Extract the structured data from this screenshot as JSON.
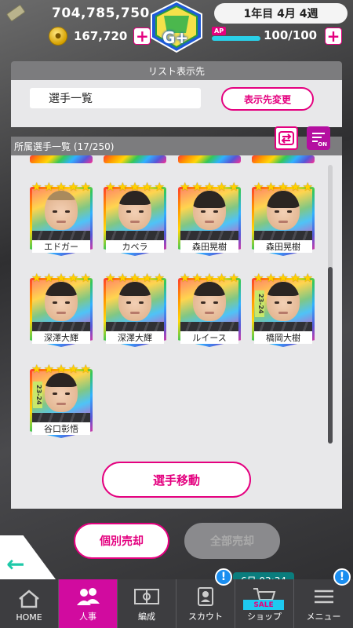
{
  "header": {
    "money": "704,785,750",
    "coins": "167,720",
    "date": "1年目 4月 4週",
    "ap_label": "AP",
    "ap_value": "100/100",
    "ap_fraction": 1.0,
    "rank_text": "G+"
  },
  "list_destination": {
    "title": "リスト表示先",
    "current": "選手一覧",
    "change_button": "表示先変更"
  },
  "roster": {
    "title": "所属選手一覧 (17/250)",
    "sort_on_label": "ON",
    "players": [
      {
        "name": "エドガー",
        "season": "",
        "hair": "blond"
      },
      {
        "name": "カベラ",
        "season": "",
        "hair": "dark"
      },
      {
        "name": "森田晃樹",
        "season": "",
        "hair": "long"
      },
      {
        "name": "森田晃樹",
        "season": "",
        "hair": "long"
      },
      {
        "name": "深澤大輝",
        "season": "",
        "hair": "dark"
      },
      {
        "name": "深澤大輝",
        "season": "",
        "hair": "dark"
      },
      {
        "name": "ルイース",
        "season": "",
        "hair": "dark"
      },
      {
        "name": "橋岡大樹",
        "season": "23-24",
        "hair": "dark"
      },
      {
        "name": "谷口彰悟",
        "season": "23-24",
        "hair": "dark"
      }
    ],
    "move_button": "選手移動"
  },
  "actions": {
    "individual_sell": "個別売却",
    "all_sell": "全部売却"
  },
  "nav": {
    "items": [
      {
        "label": "HOME",
        "icon": "home-icon"
      },
      {
        "label": "人事",
        "icon": "people-icon"
      },
      {
        "label": "編成",
        "icon": "field-icon"
      },
      {
        "label": "スカウト",
        "icon": "scout-icon"
      },
      {
        "label": "ショップ",
        "icon": "cart-icon"
      },
      {
        "label": "メニュー",
        "icon": "menu-icon"
      }
    ],
    "scout_badge": "!",
    "menu_badge": "!",
    "shop_timer": "6日 03:34",
    "sale_label": "SALE"
  },
  "colors": {
    "accent": "#e4007f",
    "nav_active": "#d10b9f",
    "ap_bar": "#2ad0e8",
    "badge": "#1a8ef0"
  }
}
